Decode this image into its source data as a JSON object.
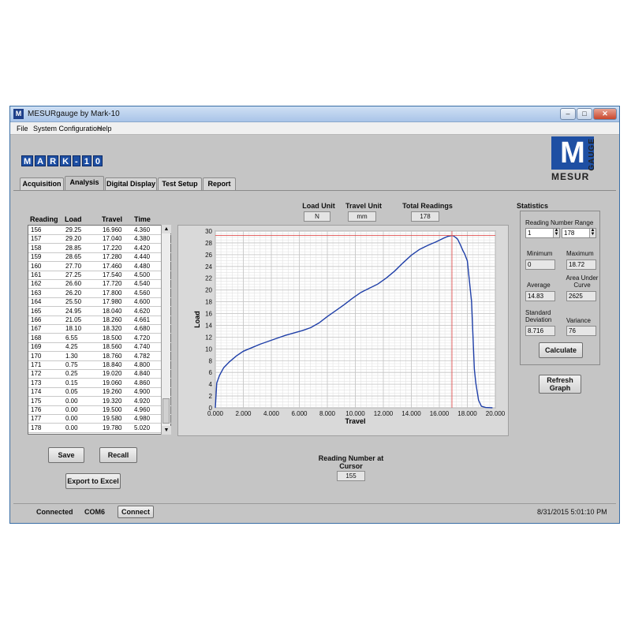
{
  "window": {
    "title": "MESURgauge by Mark-10",
    "app_icon": "M"
  },
  "controls": {
    "minimize": "–",
    "maximize": "□",
    "close": "✕"
  },
  "menu": [
    "File",
    "System Configuration",
    "Help"
  ],
  "brand": {
    "mark10": [
      "M",
      "A",
      "R",
      "K",
      "-",
      "1",
      "0"
    ],
    "mesur_m": "M",
    "mesur": "MESUR",
    "gauge": "GAUGE"
  },
  "tabs": [
    "Acquisition",
    "Analysis",
    "Digital Display",
    "Test Setup",
    "Report"
  ],
  "units": {
    "load_unit_label": "Load Unit",
    "load_unit": "N",
    "travel_unit_label": "Travel Unit",
    "travel_unit": "mm",
    "total_readings_label": "Total Readings",
    "total_readings": "178"
  },
  "table": {
    "headers": [
      "Reading",
      "Load",
      "Travel",
      "Time"
    ],
    "rows": [
      [
        "156",
        "29.25",
        "16.960",
        "4.360"
      ],
      [
        "157",
        "29.20",
        "17.040",
        "4.380"
      ],
      [
        "158",
        "28.85",
        "17.220",
        "4.420"
      ],
      [
        "159",
        "28.65",
        "17.280",
        "4.440"
      ],
      [
        "160",
        "27.70",
        "17.460",
        "4.480"
      ],
      [
        "161",
        "27.25",
        "17.540",
        "4.500"
      ],
      [
        "162",
        "26.60",
        "17.720",
        "4.540"
      ],
      [
        "163",
        "26.20",
        "17.800",
        "4.560"
      ],
      [
        "164",
        "25.50",
        "17.980",
        "4.600"
      ],
      [
        "165",
        "24.95",
        "18.040",
        "4.620"
      ],
      [
        "166",
        "21.05",
        "18.260",
        "4.661"
      ],
      [
        "167",
        "18.10",
        "18.320",
        "4.680"
      ],
      [
        "168",
        "6.55",
        "18.500",
        "4.720"
      ],
      [
        "169",
        "4.25",
        "18.560",
        "4.740"
      ],
      [
        "170",
        "1.30",
        "18.760",
        "4.782"
      ],
      [
        "171",
        "0.75",
        "18.840",
        "4.800"
      ],
      [
        "172",
        "0.25",
        "19.020",
        "4.840"
      ],
      [
        "173",
        "0.15",
        "19.060",
        "4.860"
      ],
      [
        "174",
        "0.05",
        "19.260",
        "4.900"
      ],
      [
        "175",
        "0.00",
        "19.320",
        "4.920"
      ],
      [
        "176",
        "0.00",
        "19.500",
        "4.960"
      ],
      [
        "177",
        "0.00",
        "19.580",
        "4.980"
      ],
      [
        "178",
        "0.00",
        "19.780",
        "5.020"
      ]
    ]
  },
  "chart_data": {
    "type": "line",
    "xlabel": "Travel",
    "ylabel": "Load",
    "xlim": [
      0,
      20
    ],
    "ylim": [
      0,
      30
    ],
    "x_ticks": [
      "0.000",
      "2.000",
      "4.000",
      "6.000",
      "8.000",
      "10.000",
      "12.000",
      "14.000",
      "16.000",
      "18.000",
      "20.000"
    ],
    "y_ticks": [
      "0",
      "2",
      "4",
      "6",
      "8",
      "10",
      "12",
      "14",
      "16",
      "18",
      "20",
      "22",
      "24",
      "26",
      "28",
      "30"
    ],
    "grid": true,
    "cursor": {
      "x": 16.9,
      "y": 29.25
    },
    "series": [
      {
        "color": "#1f3fa8",
        "x": [
          0,
          0.1,
          0.3,
          0.6,
          1.0,
          1.5,
          2.0,
          2.6,
          3.2,
          3.8,
          4.4,
          5.0,
          5.6,
          6.2,
          6.8,
          7.4,
          8.0,
          8.6,
          9.2,
          9.8,
          10.4,
          11.0,
          11.6,
          12.2,
          12.8,
          13.4,
          14.0,
          14.6,
          15.2,
          15.8,
          16.3,
          16.6,
          16.9,
          17.0,
          17.2,
          17.3,
          17.5,
          17.7,
          17.8,
          18.0,
          18.3,
          18.5,
          18.6,
          18.8,
          19.0,
          19.3,
          19.8
        ],
        "y": [
          0,
          4.2,
          5.5,
          6.8,
          7.8,
          8.8,
          9.6,
          10.2,
          10.8,
          11.3,
          11.8,
          12.3,
          12.7,
          13.1,
          13.6,
          14.4,
          15.5,
          16.5,
          17.5,
          18.6,
          19.6,
          20.3,
          21.0,
          22.0,
          23.2,
          24.6,
          25.9,
          26.9,
          27.6,
          28.2,
          28.8,
          29.1,
          29.25,
          29.2,
          28.85,
          28.65,
          27.7,
          26.6,
          26.2,
          24.95,
          18.1,
          6.55,
          4.25,
          1.3,
          0.25,
          0.05,
          0
        ]
      }
    ]
  },
  "cursor_readout": {
    "label": "Reading Number at Cursor",
    "value": "155"
  },
  "buttons": {
    "save": "Save",
    "recall": "Recall",
    "export": "Export to Excel",
    "refresh": "Refresh Graph",
    "calculate": "Calculate",
    "connect": "Connect"
  },
  "statistics": {
    "title": "Statistics",
    "range_label": "Reading Number Range",
    "range_from": "1",
    "range_to": "178",
    "minimum_label": "Minimum",
    "minimum": "0",
    "maximum_label": "Maximum",
    "maximum": "18.72",
    "average_label": "Average",
    "average": "14.83",
    "area_label": "Area Under Curve",
    "area": "2625",
    "std_label": "Standard Deviation",
    "std": "8.716",
    "variance_label": "Variance",
    "variance": "76"
  },
  "status": {
    "connected": "Connected",
    "port": "COM6",
    "datetime": "8/31/2015 5:01:10 PM"
  }
}
